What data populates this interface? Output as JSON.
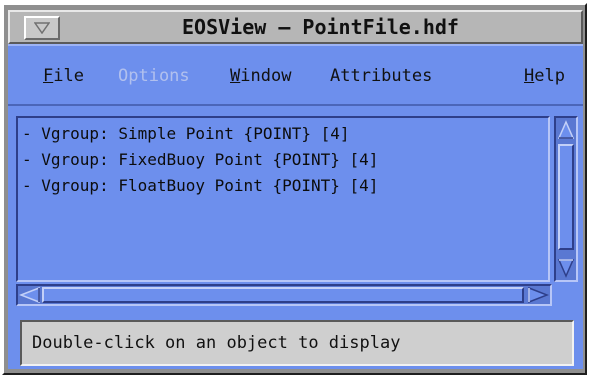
{
  "window": {
    "title": "EOSView – PointFile.hdf"
  },
  "menubar": {
    "items": [
      {
        "mnemonic": "F",
        "rest": "ile",
        "enabled": true
      },
      {
        "mnemonic": "",
        "rest": "Options",
        "enabled": false
      },
      {
        "mnemonic": "W",
        "rest": "indow",
        "enabled": true
      },
      {
        "mnemonic": "",
        "rest": "Attributes",
        "enabled": true
      },
      {
        "mnemonic": "H",
        "rest": "elp",
        "enabled": true
      }
    ]
  },
  "list": {
    "items": [
      {
        "label": "- Vgroup: Simple Point {POINT} [4]"
      },
      {
        "label": "- Vgroup: FixedBuoy Point {POINT} [4]"
      },
      {
        "label": "- Vgroup: FloatBuoy Point {POINT} [4]"
      }
    ]
  },
  "status": {
    "message": "Double-click on an object to display"
  },
  "colors": {
    "client_bg": "#6d8fed",
    "titlebar_bg": "#b6b6b6",
    "statusbar_bg": "#cfcfcf"
  },
  "icons": {
    "window_menu": "window-menu-icon",
    "scroll_up": "arrow-up-icon",
    "scroll_down": "arrow-down-icon",
    "scroll_left": "arrow-left-icon",
    "scroll_right": "arrow-right-icon"
  }
}
